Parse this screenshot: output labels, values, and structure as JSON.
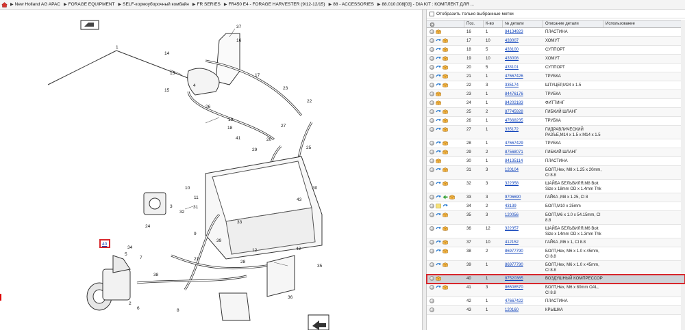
{
  "breadcrumb": [
    {
      "label": "New Holland AG APAC"
    },
    {
      "label": "FORAGE EQUIPMENT"
    },
    {
      "label": "SELF-кормоуборочный комбайн"
    },
    {
      "label": "FR SERIES"
    },
    {
      "label": "FR450 E4 - FORAGE HARVESTER (9/12-12/15)"
    },
    {
      "label": "88 - ACCESSORIES"
    },
    {
      "label": "88.010.008[03] - DIA KIT : КОМПЛЕКТ ДЛЯ ..."
    }
  ],
  "filter": {
    "label": "Отобразить только выбранные метки"
  },
  "columns": {
    "pos": "Поз.",
    "qty": "К-во",
    "num": "№ детали",
    "desc": "Описание детали",
    "use": "Использование"
  },
  "rows": [
    {
      "pos": "16",
      "qty": "1",
      "num": "84134923",
      "desc": "ПЛАСТИНА",
      "icons": [
        "dot",
        "box"
      ]
    },
    {
      "pos": "17",
      "qty": "10",
      "num": "433007",
      "desc": "ХОМУТ",
      "icons": [
        "dot",
        "arrow",
        "box"
      ]
    },
    {
      "pos": "18",
      "qty": "5",
      "num": "433100",
      "desc": "СУППОРТ",
      "icons": [
        "dot",
        "arrow",
        "box"
      ]
    },
    {
      "pos": "19",
      "qty": "10",
      "num": "433008",
      "desc": "ХОМУТ",
      "icons": [
        "dot",
        "arrow",
        "box"
      ]
    },
    {
      "pos": "20",
      "qty": "5",
      "num": "433101",
      "desc": "СУППОРТ",
      "icons": [
        "dot",
        "arrow",
        "box"
      ]
    },
    {
      "pos": "21",
      "qty": "1",
      "num": "47667426",
      "desc": "ТРУБКА",
      "icons": [
        "dot",
        "arrow",
        "box"
      ]
    },
    {
      "pos": "22",
      "qty": "3",
      "num": "335174",
      "desc": "ШТУЦЕР,М24 x 1.5",
      "icons": [
        "dot",
        "arrow",
        "box"
      ]
    },
    {
      "pos": "23",
      "qty": "1",
      "num": "84476176",
      "desc": "ТРУБКА",
      "icons": [
        "dot",
        "box"
      ]
    },
    {
      "pos": "24",
      "qty": "1",
      "num": "84202183",
      "desc": "ФИТТИНГ",
      "icons": [
        "dot",
        "box"
      ]
    },
    {
      "pos": "25",
      "qty": "2",
      "num": "87745928",
      "desc": "ГИБКИЙ ШЛАНГ",
      "icons": [
        "dot",
        "arrow",
        "box"
      ]
    },
    {
      "pos": "26",
      "qty": "1",
      "num": "47668235",
      "desc": "ТРУБКА",
      "icons": [
        "dot",
        "arrow",
        "box"
      ]
    },
    {
      "pos": "27",
      "qty": "1",
      "num": "335172",
      "desc": "ГИДРАВЛИЧЕСКИЙ РАЗЪЕ,М14 x 1.5 x М14 x 1.5",
      "icons": [
        "dot",
        "arrow",
        "box"
      ]
    },
    {
      "pos": "28",
      "qty": "1",
      "num": "47667429",
      "desc": "ТРУБКА",
      "icons": [
        "dot",
        "arrow",
        "box"
      ]
    },
    {
      "pos": "29",
      "qty": "2",
      "num": "87568071",
      "desc": "ГИБКИЙ ШЛАНГ",
      "icons": [
        "dot",
        "arrow",
        "box"
      ]
    },
    {
      "pos": "30",
      "qty": "1",
      "num": "84135114",
      "desc": "ПЛАСТИНА",
      "icons": [
        "dot",
        "box"
      ]
    },
    {
      "pos": "31",
      "qty": "3",
      "num": "120104",
      "desc": "БОЛТ,Hex, М8 x 1.25 x 20mm, Cl 8.8",
      "icons": [
        "dot",
        "arrow",
        "box"
      ]
    },
    {
      "pos": "32",
      "qty": "3",
      "num": "322358",
      "desc": "ШАЙБА БЕЛЬВИЛЯ,M8 Bolt Size x 18mm OD x 1.4mm Thk",
      "icons": [
        "dot",
        "arrow",
        "box"
      ]
    },
    {
      "pos": "33",
      "qty": "3",
      "num": "9706690",
      "desc": "ГАЙКА ,М8 x 1.25, Cl 8",
      "icons": [
        "dot",
        "arrow",
        "green",
        "box"
      ]
    },
    {
      "pos": "34",
      "qty": "2",
      "num": "43139",
      "desc": "БОЛТ,М10 x 25mm",
      "icons": [
        "dot",
        "box2",
        "arrow"
      ]
    },
    {
      "pos": "35",
      "qty": "3",
      "num": "120056",
      "desc": "БОЛТ,М6 x 1.0 x 54.15mm, Cl 8.8",
      "icons": [
        "dot",
        "arrow",
        "box"
      ]
    },
    {
      "pos": "36",
      "qty": "12",
      "num": "322357",
      "desc": "ШАЙБА БЕЛЬВИЛЯ,M6 Bolt Size x 14mm OD x 1.3mm Thk",
      "icons": [
        "dot",
        "arrow",
        "box"
      ]
    },
    {
      "pos": "37",
      "qty": "10",
      "num": "412152",
      "desc": "ГАЙКА ,М6 x 1, Cl 8.8",
      "icons": [
        "dot",
        "arrow",
        "box"
      ]
    },
    {
      "pos": "38",
      "qty": "2",
      "num": "86977790",
      "desc": "БОЛТ,Hex, М6 x 1.0 x 45mm, Cl 8.8",
      "icons": [
        "dot",
        "arrow",
        "box"
      ]
    },
    {
      "pos": "39",
      "qty": "1",
      "num": "86977790",
      "desc": "БОЛТ,Hex, М6 x 1.0 x 45mm, Cl 8.8",
      "icons": [
        "dot",
        "arrow",
        "box"
      ]
    },
    {
      "pos": "40",
      "qty": "1",
      "num": "87520365",
      "desc": "ВОЗДУШНЫЙ КОМПРЕССОР",
      "icons": [
        "dot",
        "box"
      ],
      "selected": true
    },
    {
      "pos": "41",
      "qty": "3",
      "num": "86508570",
      "desc": "БОЛТ,Hex, М6 x 80mm OAL, Cl 8.8",
      "icons": [
        "dot",
        "arrow",
        "box"
      ]
    },
    {
      "pos": "42",
      "qty": "1",
      "num": "47667422",
      "desc": "ПЛАСТИНА",
      "icons": [
        "dot"
      ]
    },
    {
      "pos": "43",
      "qty": "1",
      "num": "120160",
      "desc": "КРЫШКА",
      "icons": [
        "dot"
      ]
    }
  ],
  "diagram": {
    "callouts": [
      "37",
      "1",
      "16",
      "14",
      "17",
      "13",
      "4",
      "23",
      "15",
      "26",
      "22",
      "19",
      "18",
      "27",
      "20",
      "41",
      "29",
      "25",
      "30",
      "10",
      "11",
      "3",
      "31",
      "32",
      "43",
      "33",
      "24",
      "34",
      "9",
      "39",
      "12",
      "5",
      "7",
      "38",
      "21",
      "28",
      "42",
      "35",
      "36",
      "8",
      "6",
      "2",
      "40"
    ]
  }
}
